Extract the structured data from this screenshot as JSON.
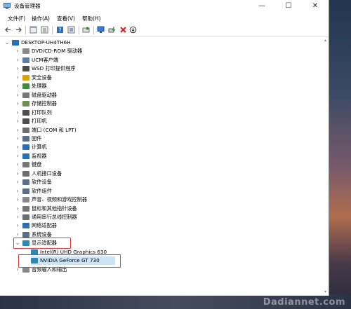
{
  "window": {
    "title": "设备管理器",
    "controls": {
      "minimize": "—",
      "maximize": "☐",
      "close": "✕"
    }
  },
  "menu": [
    "文件(F)",
    "操作(A)",
    "查看(V)",
    "帮助(H)"
  ],
  "toolbar": [
    "back-icon",
    "forward-icon",
    "properties-icon",
    "details-icon",
    "help-icon",
    "driver-icon",
    "scan-icon",
    "monitor-icon",
    "update-driver-icon",
    "uninstall-icon",
    "disable-icon"
  ],
  "tree": {
    "root": "DESKTOP-UH4TH6H",
    "categories": [
      {
        "label": "DVD/CD-ROM 驱动器",
        "icon": "disc-drive-icon",
        "color": "#8a8a8a"
      },
      {
        "label": "UCM客户端",
        "icon": "ucm-icon",
        "color": "#5b7fa8"
      },
      {
        "label": "WSD 打印提供程序",
        "icon": "printer-icon",
        "color": "#4d4d4d"
      },
      {
        "label": "安全设备",
        "icon": "security-icon",
        "color": "#d9a400"
      },
      {
        "label": "处理器",
        "icon": "processor-icon",
        "color": "#3d8a3d"
      },
      {
        "label": "磁盘驱动器",
        "icon": "disk-icon",
        "color": "#777777"
      },
      {
        "label": "存储控制器",
        "icon": "storage-controller-icon",
        "color": "#6a8e56"
      },
      {
        "label": "打印队列",
        "icon": "print-queue-icon",
        "color": "#4d4d4d"
      },
      {
        "label": "打印机",
        "icon": "printer-icon",
        "color": "#4d4d4d"
      },
      {
        "label": "端口 (COM 和 LPT)",
        "icon": "port-icon",
        "color": "#6d6d6d"
      },
      {
        "label": "固件",
        "icon": "firmware-icon",
        "color": "#5a6f86"
      },
      {
        "label": "计算机",
        "icon": "computer-icon",
        "color": "#2a6fb6"
      },
      {
        "label": "监视器",
        "icon": "monitor-icon",
        "color": "#2a6fb6"
      },
      {
        "label": "键盘",
        "icon": "keyboard-icon",
        "color": "#777777"
      },
      {
        "label": "人机接口设备",
        "icon": "hid-icon",
        "color": "#6d6d6d"
      },
      {
        "label": "软件设备",
        "icon": "software-device-icon",
        "color": "#5a6f86"
      },
      {
        "label": "软件组件",
        "icon": "software-component-icon",
        "color": "#5a6f86"
      },
      {
        "label": "声音、视频和游戏控制器",
        "icon": "sound-icon",
        "color": "#888888"
      },
      {
        "label": "鼠标和其他指针设备",
        "icon": "mouse-icon",
        "color": "#777777"
      },
      {
        "label": "通用串行总线控制器",
        "icon": "usb-icon",
        "color": "#6d6d6d"
      },
      {
        "label": "网络适配器",
        "icon": "network-icon",
        "color": "#2a6fb6"
      },
      {
        "label": "系统设备",
        "icon": "system-device-icon",
        "color": "#5a6f86"
      },
      {
        "label": "显示适配器",
        "icon": "display-adapter-icon",
        "color": "#2a8ab6",
        "expanded": true,
        "children": [
          {
            "label": "Intel(R) UHD Graphics 630",
            "icon": "display-adapter-icon"
          },
          {
            "label": "NVIDIA GeForce GT 730",
            "icon": "display-adapter-icon",
            "selected": true
          }
        ]
      },
      {
        "label": "音频输入和输出",
        "icon": "audio-io-icon",
        "color": "#888888"
      }
    ]
  },
  "colors": {
    "selection": "#cce4f7",
    "highlight": "#e23a3a",
    "window": "#ffffff"
  },
  "watermark": "Dadiannet.com"
}
